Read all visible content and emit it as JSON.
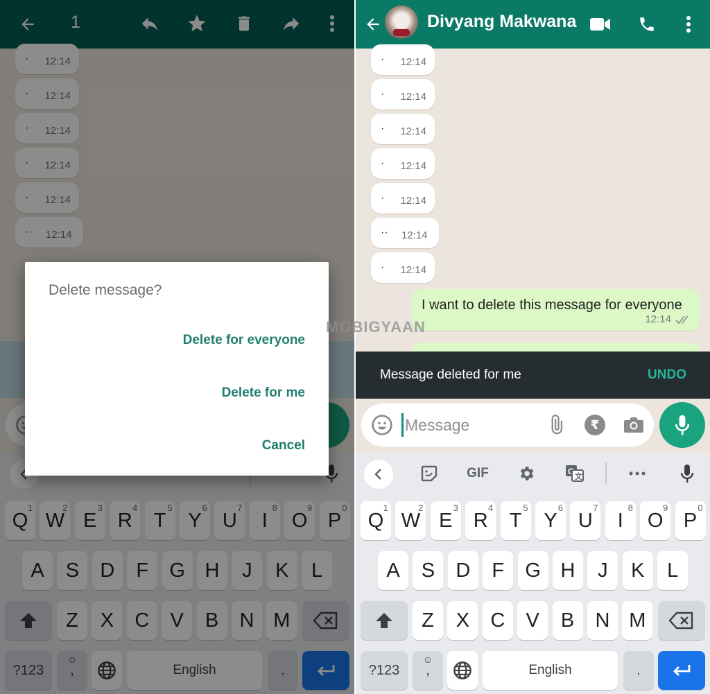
{
  "left": {
    "appbar": {
      "selected_count": "1",
      "icons": [
        "back-arrow-icon",
        "reply-icon",
        "star-icon",
        "delete-icon",
        "forward-icon",
        "more-vert-icon"
      ]
    },
    "messages": [
      {
        "text": "·",
        "time": "12:14"
      },
      {
        "text": "·",
        "time": "12:14"
      },
      {
        "text": "·",
        "time": "12:14"
      },
      {
        "text": "·",
        "time": "12:14"
      },
      {
        "text": "·",
        "time": "12:14"
      },
      {
        "text": "··",
        "time": "12:14"
      }
    ],
    "dialog": {
      "title": "Delete message?",
      "actions": {
        "everyone": "Delete for everyone",
        "me": "Delete for me",
        "cancel": "Cancel"
      }
    }
  },
  "right": {
    "appbar": {
      "contact_name": "Divyang Makwana",
      "icons": [
        "back-arrow-icon",
        "video-call-icon",
        "voice-call-icon",
        "more-vert-icon"
      ]
    },
    "messages": [
      {
        "text": "·",
        "time": "12:14"
      },
      {
        "text": "·",
        "time": "12:14"
      },
      {
        "text": "·",
        "time": "12:14"
      },
      {
        "text": "·",
        "time": "12:14"
      },
      {
        "text": "·",
        "time": "12:14"
      },
      {
        "text": "··",
        "time": "12:14"
      },
      {
        "text": "·",
        "time": "12:14"
      }
    ],
    "outgoing": {
      "text": "I want to delete this message for everyone",
      "time": "12:14",
      "status": "read-double-check"
    },
    "snackbar": {
      "message": "Message deleted for me",
      "action": "UNDO"
    }
  },
  "composer": {
    "placeholder": "Message",
    "icons": [
      "emoji-icon",
      "attach-icon",
      "rupee-payment-icon",
      "camera-icon",
      "mic-icon"
    ]
  },
  "keyboard": {
    "toolbar": {
      "gif_label": "GIF",
      "icons": [
        "chevron-left-icon",
        "sticker-icon",
        "gif-icon",
        "settings-gear-icon",
        "translate-icon",
        "more-horiz-icon",
        "voice-input-mic-icon"
      ]
    },
    "row1": [
      {
        "key": "Q",
        "hint": "1"
      },
      {
        "key": "W",
        "hint": "2"
      },
      {
        "key": "E",
        "hint": "3"
      },
      {
        "key": "R",
        "hint": "4"
      },
      {
        "key": "T",
        "hint": "5"
      },
      {
        "key": "Y",
        "hint": "6"
      },
      {
        "key": "U",
        "hint": "7"
      },
      {
        "key": "I",
        "hint": "8"
      },
      {
        "key": "O",
        "hint": "9"
      },
      {
        "key": "P",
        "hint": "0"
      }
    ],
    "row2": [
      "A",
      "S",
      "D",
      "F",
      "G",
      "H",
      "J",
      "K",
      "L"
    ],
    "row3": [
      "Z",
      "X",
      "C",
      "V",
      "B",
      "N",
      "M"
    ],
    "symbols_label": "?123",
    "comma_label": ",",
    "space_label": "English",
    "period_label": "."
  },
  "watermark": "MOBIGYAAN",
  "colors": {
    "header_green": "#0a7a66",
    "accent_teal": "#128c7e",
    "fab_green": "#1aa37f",
    "outgoing_bubble": "#dcf8c6",
    "chat_bg": "#ece5dd",
    "snackbar_bg": "#262d31",
    "enter_key_blue": "#1a73e8"
  }
}
